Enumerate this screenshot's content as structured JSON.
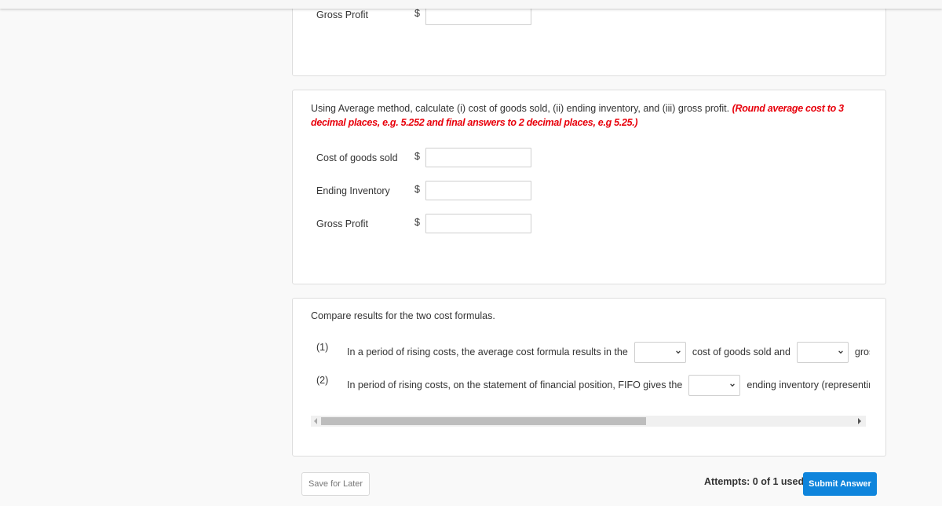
{
  "fifo_section": {
    "rows": [
      {
        "label": "Gross Profit",
        "currency": "$",
        "value": ""
      }
    ]
  },
  "average_section": {
    "question": "Using Average method, calculate (i) cost of goods sold, (ii) ending inventory, and (iii) gross profit.",
    "hint": "(Round average cost to 3 decimal places, e.g. 5.252 and final answers to 2 decimal places, e.g 5.25.)",
    "rows": [
      {
        "label": "Cost of goods sold",
        "currency": "$",
        "value": ""
      },
      {
        "label": "Ending Inventory",
        "currency": "$",
        "value": ""
      },
      {
        "label": "Gross Profit",
        "currency": "$",
        "value": ""
      }
    ]
  },
  "compare_section": {
    "title": "Compare results for the two cost formulas.",
    "items": [
      {
        "number": "(1)",
        "text_1": "In a period of rising costs, the average cost formula results in the",
        "select_1": "",
        "text_2": "cost of goods sold and",
        "select_2": "",
        "text_3": "gross p"
      },
      {
        "number": "(2)",
        "text_1": "In period of rising costs, on the statement of financial position, FIFO gives the",
        "select_1": "",
        "text_2": "ending inventory (representin"
      }
    ],
    "scroll_position": 0.0
  },
  "footer": {
    "save_label": "Save for Later",
    "attempts_text": "Attempts: 0 of 1 used",
    "submit_label": "Submit Answer"
  },
  "colors": {
    "hint": "#e8000b",
    "submit": "#0f85dc"
  }
}
